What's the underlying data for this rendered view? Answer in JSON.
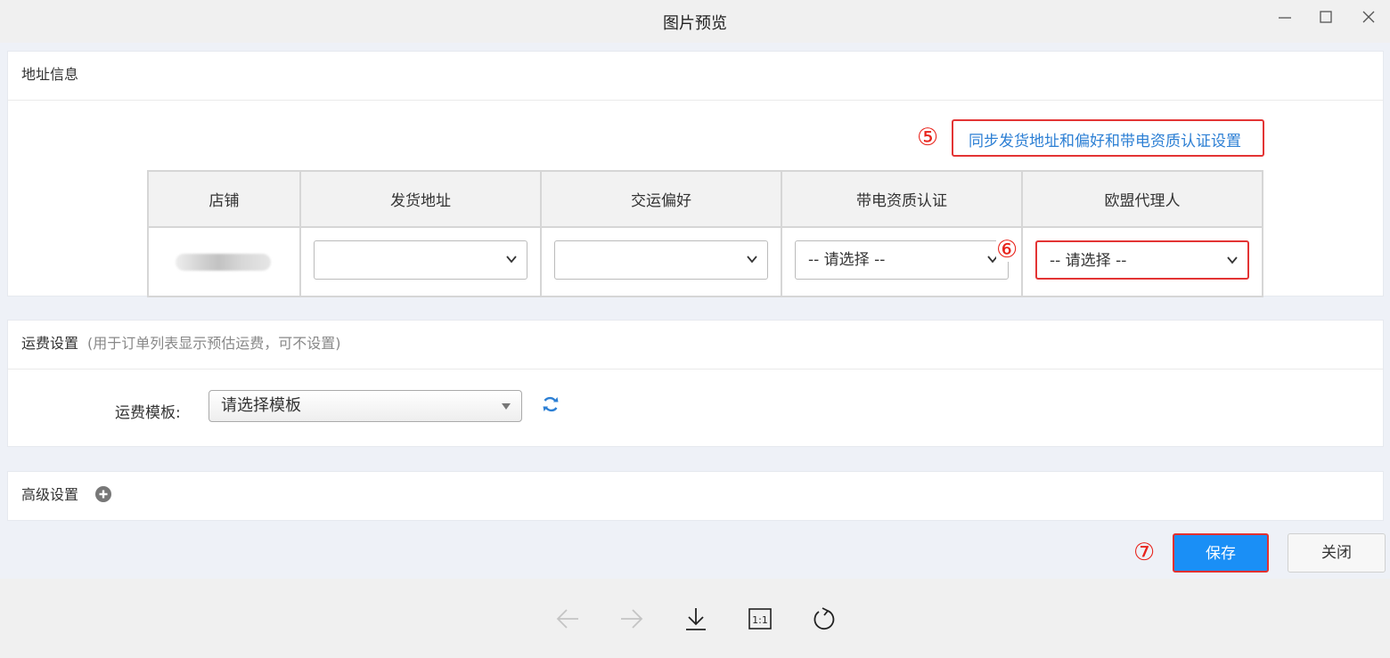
{
  "window": {
    "title": "图片预览"
  },
  "address_section": {
    "title": "地址信息",
    "marker_5": "⑤",
    "sync_link": "同步发货地址和偏好和带电资质认证设置",
    "marker_6": "⑥",
    "columns": [
      "店铺",
      "发货地址",
      "交运偏好",
      "带电资质认证",
      "欧盟代理人"
    ],
    "row": {
      "shipping_address": "",
      "shipping_preference": "",
      "battery_cert": "-- 请选择 --",
      "eu_agent": "-- 请选择 --"
    }
  },
  "freight_section": {
    "title": "运费设置",
    "note": "(用于订单列表显示预估运费，可不设置)",
    "template_label": "运费模板:",
    "template_value": "请选择模板"
  },
  "advanced_section": {
    "title": "高级设置"
  },
  "actions": {
    "marker_7": "⑦",
    "save": "保存",
    "close": "关闭"
  },
  "icons": {
    "minimize": "minimize-icon",
    "maximize": "maximize-icon",
    "close": "close-icon",
    "refresh": "refresh-icon",
    "plus": "plus-circle-icon",
    "prev": "arrow-left-icon",
    "next": "arrow-right-icon",
    "download": "download-icon",
    "actual_size": "actual-size-icon",
    "rotate": "rotate-icon"
  },
  "colors": {
    "link": "#2c7fd4",
    "primary": "#1a8ff6",
    "annotation": "#e8231b",
    "background": "#eef1f7"
  }
}
